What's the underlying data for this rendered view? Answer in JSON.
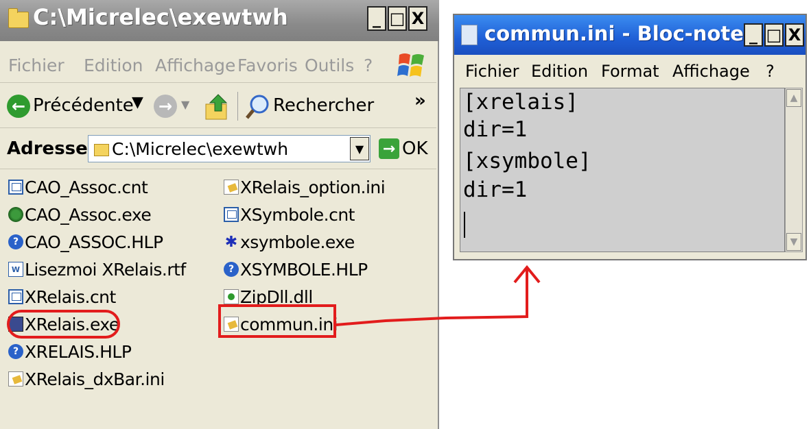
{
  "explorer": {
    "title": "C:\\Micrelec\\exewtwh",
    "window_buttons": [
      "_",
      "□",
      "X"
    ],
    "menu": [
      "Fichier",
      "Edition",
      "Affichage",
      "Favoris",
      "Outils",
      "?"
    ],
    "toolbar": {
      "back_label": "Précédente",
      "search_label": "Rechercher",
      "more": "»"
    },
    "address": {
      "label": "Adresse",
      "value": "C:\\Micrelec\\exewtwh",
      "go_label": "OK"
    },
    "files_col1": [
      {
        "name": "CAO_Assoc.cnt",
        "icon": "cnt-file-icon"
      },
      {
        "name": "CAO_Assoc.exe",
        "icon": "exe-app-icon"
      },
      {
        "name": "CAO_ASSOC.HLP",
        "icon": "help-file-icon"
      },
      {
        "name": "Lisezmoi XRelais.rtf",
        "icon": "rtf-file-icon"
      },
      {
        "name": "XRelais.cnt",
        "icon": "cnt-file-icon"
      },
      {
        "name": "XRelais.exe",
        "icon": "exe-app-icon"
      },
      {
        "name": "XRELAIS.HLP",
        "icon": "help-file-icon"
      },
      {
        "name": "XRelais_dxBar.ini",
        "icon": "ini-file-icon"
      }
    ],
    "files_col2": [
      {
        "name": "XRelais_option.ini",
        "icon": "ini-file-icon"
      },
      {
        "name": "XSymbole.cnt",
        "icon": "cnt-file-icon"
      },
      {
        "name": "xsymbole.exe",
        "icon": "exe-app-icon"
      },
      {
        "name": "XSYMBOLE.HLP",
        "icon": "help-file-icon"
      },
      {
        "name": "ZipDll.dll",
        "icon": "dll-file-icon"
      },
      {
        "name": "commun.ini",
        "icon": "ini-file-icon"
      }
    ]
  },
  "notepad": {
    "title": "commun.ini - Bloc-notes",
    "window_buttons": [
      "_",
      "□",
      "X"
    ],
    "menu": [
      "Fichier",
      "Edition",
      "Format",
      "Affichage",
      "?"
    ],
    "lines": [
      "[xrelais]",
      "dir=1",
      "[xsymbole]",
      "dir=1"
    ]
  },
  "colors": {
    "highlight": "#e21c1c",
    "explorer_title_bar": "#8a8a8a",
    "notepad_title_bar": "#1f5fd6",
    "window_face": "#ece9d8"
  }
}
